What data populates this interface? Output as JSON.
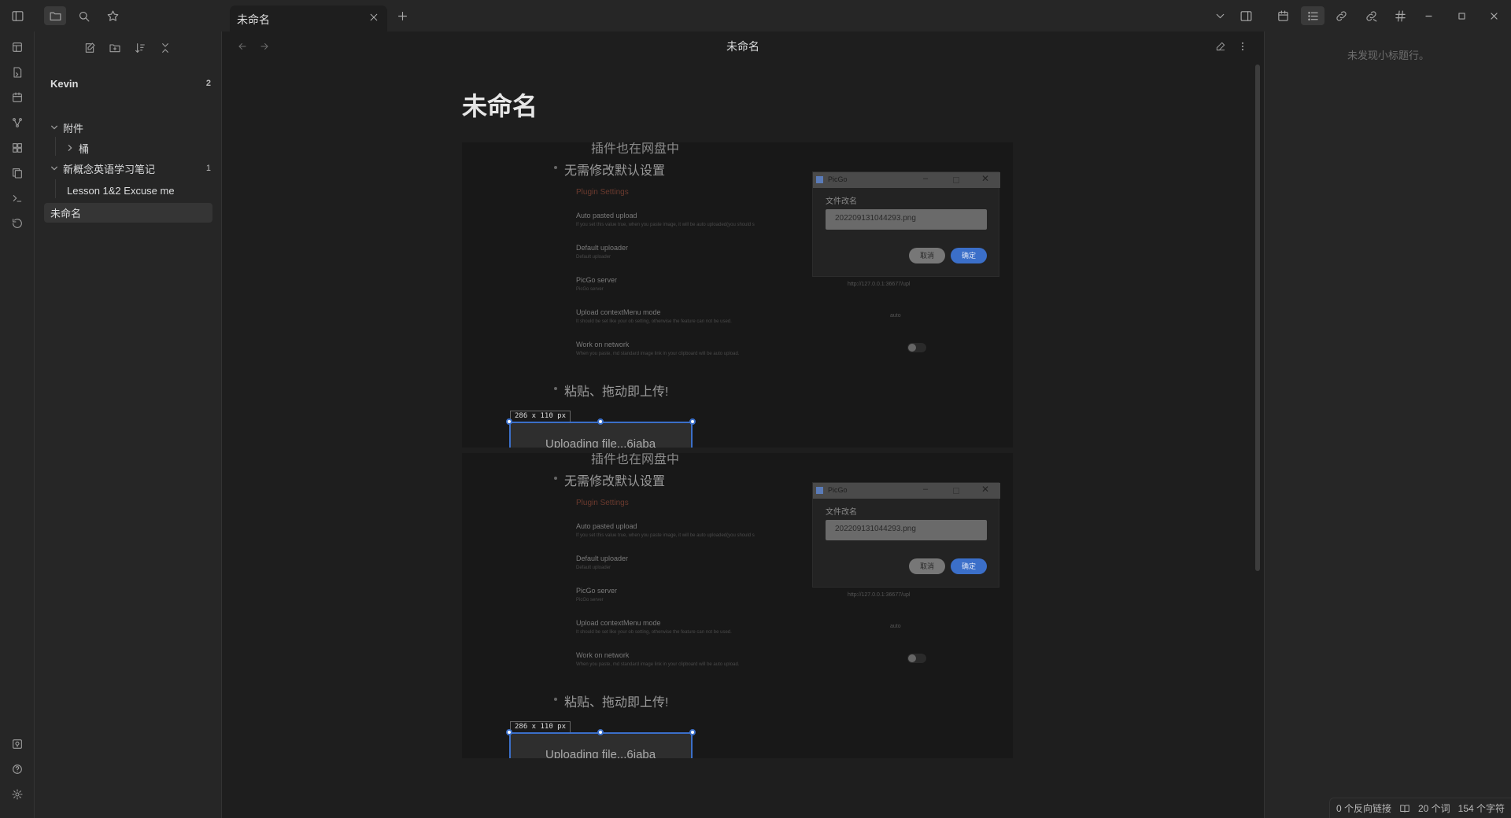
{
  "tab": {
    "title": "未命名"
  },
  "explorer": {
    "vault": {
      "label": "Kevin",
      "count": "2"
    },
    "folder_attachments": {
      "label": "附件"
    },
    "subfolder_bucket": {
      "label": "桶"
    },
    "folder_nce": {
      "label": "新概念英语学习笔记",
      "count": "1"
    },
    "note_lesson": {
      "label": "Lesson 1&2 Excuse me"
    },
    "note_untitled": {
      "label": "未命名"
    }
  },
  "editor": {
    "view_title": "未命名",
    "doc_title": "未命名"
  },
  "embed": {
    "line_top": "插件也在网盘中",
    "bullet1": "无需修改默认设置",
    "settings_title": "Plugin Settings",
    "settings": [
      {
        "label": "Auto pasted upload",
        "desc": "If you set this value true, when you paste image, it will be auto uploaded(you should s"
      },
      {
        "label": "Default uploader",
        "desc": "Default uploader"
      },
      {
        "label": "PicGo server",
        "desc": "PicGo server"
      },
      {
        "label": "Upload contextMenu mode",
        "desc": "It should be set like your ob setting, otherwise the feature can not be used."
      },
      {
        "label": "Work on network",
        "desc": "When you paste, md standard image link in your clipboard will be auto upload."
      }
    ],
    "server_url": "http://127.0.0.1:36677/upl",
    "mode_value": "auto",
    "dialog": {
      "title": "PicGo",
      "label": "文件改名",
      "filename": "202209131044293.png",
      "cancel": "取消",
      "confirm": "确定"
    },
    "bullet2": "粘贴、拖动即上传!",
    "size_tag": "286 x 110  px",
    "uploading": "Uploading file...6jaba"
  },
  "outline": {
    "empty": "未发现小标题行。"
  },
  "status": {
    "backlinks": "0 个反向链接",
    "words": "20 个词",
    "chars": "154 个字符"
  }
}
